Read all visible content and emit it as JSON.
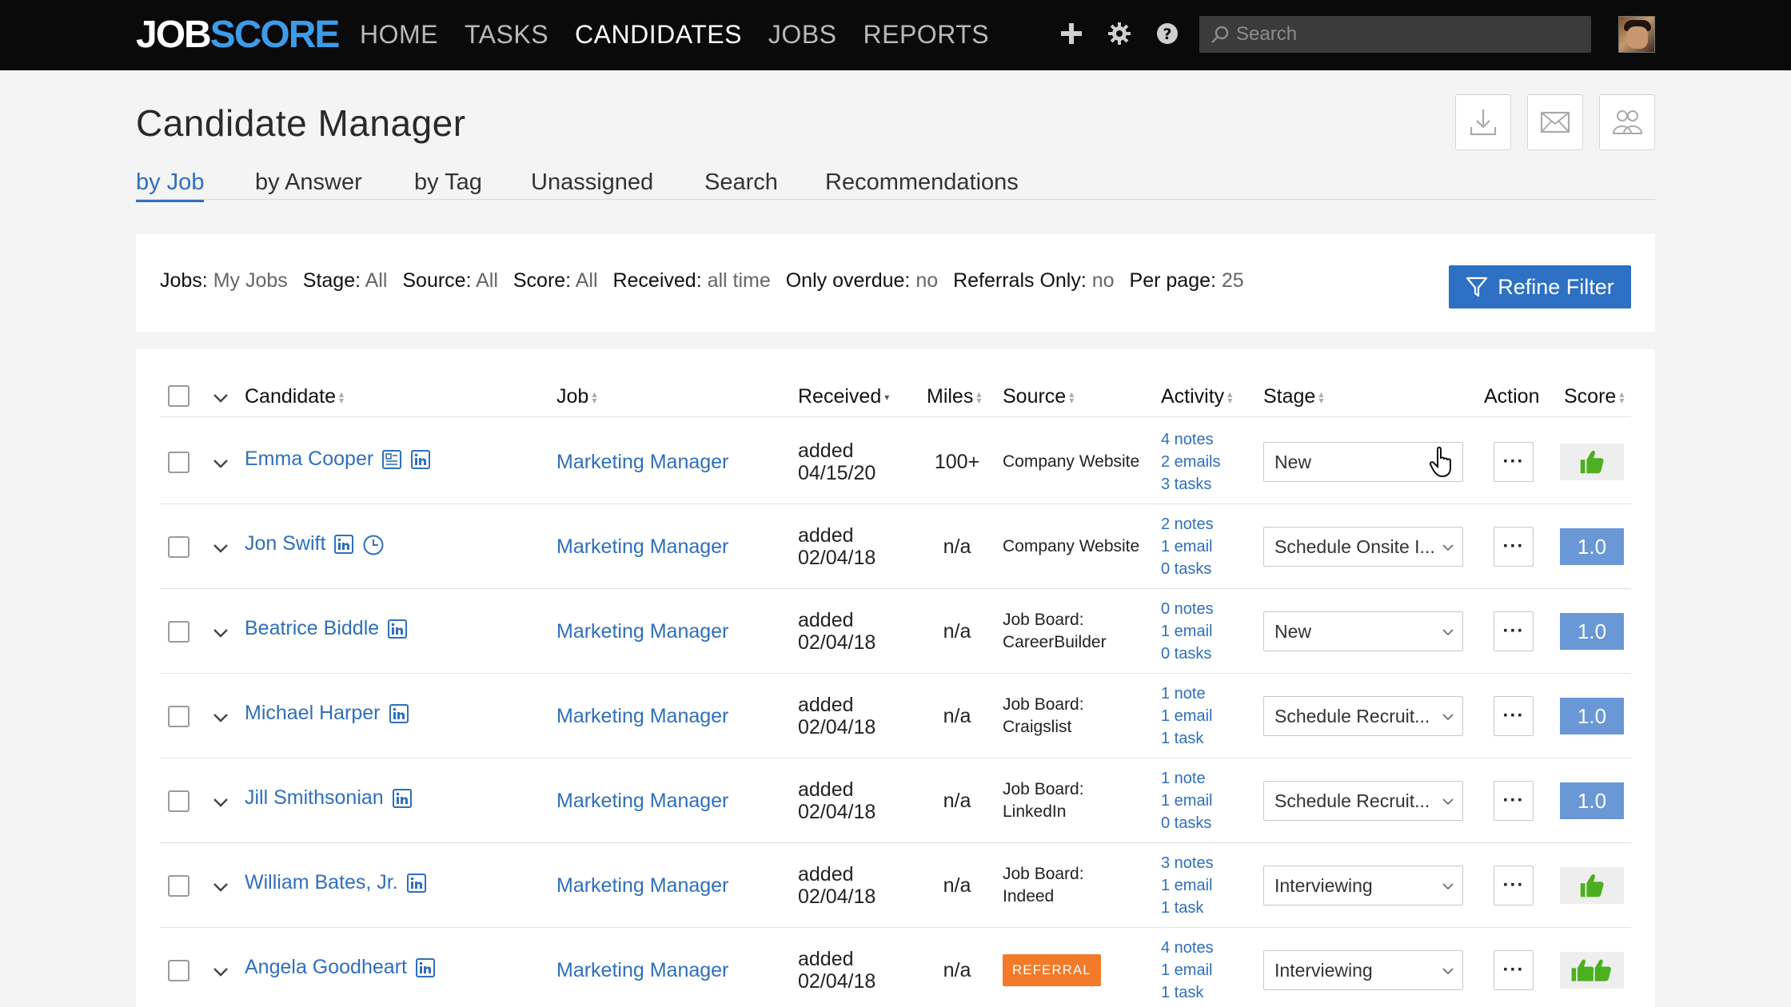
{
  "brand": {
    "job": "JOB",
    "score": "SCORE"
  },
  "nav": {
    "items": [
      "HOME",
      "TASKS",
      "CANDIDATES",
      "JOBS",
      "REPORTS"
    ],
    "active": 2
  },
  "top_icons": [
    "plus-icon",
    "gear-icon",
    "help-icon"
  ],
  "search": {
    "placeholder": "Search",
    "value": ""
  },
  "page": {
    "title": "Candidate Manager"
  },
  "header_buttons": [
    "download-icon",
    "email-icon",
    "group-icon"
  ],
  "subtabs": [
    "by Job",
    "by Answer",
    "by Tag",
    "Unassigned",
    "Search",
    "Recommendations"
  ],
  "filters": [
    {
      "key": "Jobs:",
      "value": "My Jobs"
    },
    {
      "key": "Stage:",
      "value": "All"
    },
    {
      "key": "Source:",
      "value": "All"
    },
    {
      "key": "Score:",
      "value": "All"
    },
    {
      "key": "Received:",
      "value": "all time"
    },
    {
      "key": "Only overdue:",
      "value": "no"
    },
    {
      "key": "Referrals Only:",
      "value": "no"
    },
    {
      "key": "Per page:",
      "value": "25"
    }
  ],
  "refine_label": "Refine Filter",
  "columns": {
    "candidate": "Candidate",
    "job": "Job",
    "received": "Received",
    "miles": "Miles",
    "source": "Source",
    "activity": "Activity",
    "stage": "Stage",
    "action": "Action",
    "score": "Score"
  },
  "rows": [
    {
      "name": "Emma Cooper",
      "icons": [
        "resume-icon",
        "linkedin-icon"
      ],
      "job": "Marketing Manager",
      "received": [
        "added",
        "04/15/20"
      ],
      "miles": "100+",
      "source": [
        "Company Website"
      ],
      "referral": "",
      "activity": [
        "4 notes",
        "2 emails",
        "3 tasks"
      ],
      "stage": "New",
      "score": "",
      "score_icon": "thumbs-up-icon"
    },
    {
      "name": "Jon Swift",
      "icons": [
        "linkedin-icon",
        "clock-icon"
      ],
      "job": "Marketing Manager",
      "received": [
        "added",
        "02/04/18"
      ],
      "miles": "n/a",
      "source": [
        "Company Website"
      ],
      "referral": "",
      "activity": [
        "2 notes",
        "1 email",
        "0 tasks"
      ],
      "stage": "Schedule Onsite I...",
      "score": "1.0",
      "score_icon": ""
    },
    {
      "name": "Beatrice Biddle",
      "icons": [
        "linkedin-icon"
      ],
      "job": "Marketing Manager",
      "received": [
        "added",
        "02/04/18"
      ],
      "miles": "n/a",
      "source": [
        "Job Board:",
        "CareerBuilder"
      ],
      "referral": "",
      "activity": [
        "0 notes",
        "1 email",
        "0 tasks"
      ],
      "stage": "New",
      "score": "1.0",
      "score_icon": ""
    },
    {
      "name": "Michael Harper",
      "icons": [
        "linkedin-icon"
      ],
      "job": "Marketing Manager",
      "received": [
        "added",
        "02/04/18"
      ],
      "miles": "n/a",
      "source": [
        "Job Board:",
        "Craigslist"
      ],
      "referral": "",
      "activity": [
        "1 note",
        "1 email",
        "1 task"
      ],
      "stage": "Schedule Recruit...",
      "score": "1.0",
      "score_icon": ""
    },
    {
      "name": "Jill Smithsonian",
      "icons": [
        "linkedin-icon"
      ],
      "job": "Marketing Manager",
      "received": [
        "added",
        "02/04/18"
      ],
      "miles": "n/a",
      "source": [
        "Job Board:",
        "LinkedIn"
      ],
      "referral": "",
      "activity": [
        "1 note",
        "1 email",
        "0 tasks"
      ],
      "stage": "Schedule Recruit...",
      "score": "1.0",
      "score_icon": ""
    },
    {
      "name": "William Bates, Jr.",
      "icons": [
        "linkedin-icon"
      ],
      "job": "Marketing Manager",
      "received": [
        "added",
        "02/04/18"
      ],
      "miles": "n/a",
      "source": [
        "Job Board:",
        "Indeed"
      ],
      "referral": "",
      "activity": [
        "3 notes",
        "1 email",
        "1 task"
      ],
      "stage": "Interviewing",
      "score": "",
      "score_icon": "thumbs-up-icon"
    },
    {
      "name": "Angela Goodheart",
      "icons": [
        "linkedin-icon"
      ],
      "job": "Marketing Manager",
      "received": [
        "added",
        "02/04/18"
      ],
      "miles": "n/a",
      "source": [],
      "referral": "REFERRAL",
      "activity": [
        "4 notes",
        "1 email",
        "1 task"
      ],
      "stage": "Interviewing",
      "score": "",
      "score_icon": "double-thumbs-up-icon"
    }
  ],
  "colors": {
    "accent": "#2e6fbc",
    "score_blue": "#6a97d6",
    "thumb_green": "#4caf1f",
    "referral": "#f27a28"
  }
}
